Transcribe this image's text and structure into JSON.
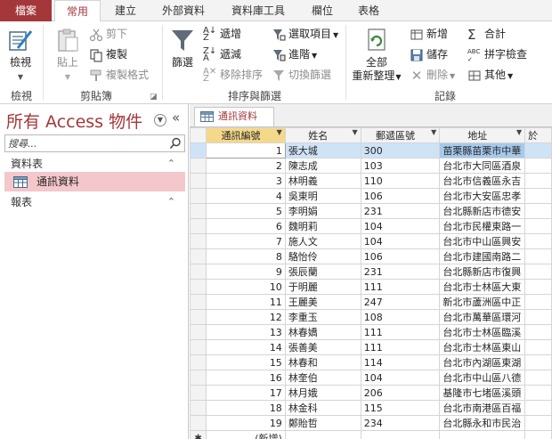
{
  "ribbon_tabs": [
    "檔案",
    "常用",
    "建立",
    "外部資料",
    "資料庫工具",
    "欄位",
    "表格"
  ],
  "ribbon": {
    "view": {
      "label1": "檢視",
      "group": "檢視"
    },
    "clipboard": {
      "paste": "貼上",
      "cut": "剪下",
      "copy": "複製",
      "format_painter": "複製格式",
      "group": "剪貼簿"
    },
    "sort_filter": {
      "filter": "篩選",
      "ascending": "遞增",
      "descending": "遞減",
      "remove_sort": "移除排序",
      "selection": "選取項目",
      "advanced": "進階",
      "toggle_filter": "切換篩選",
      "group": "排序與篩選"
    },
    "records": {
      "refresh1": "全部",
      "refresh2": "重新整理",
      "new": "新增",
      "save": "儲存",
      "delete": "刪除",
      "totals": "合計",
      "spelling": "拼字檢查",
      "more": "其他",
      "group": "記錄"
    }
  },
  "nav": {
    "title": "所有 Access 物件",
    "search_placeholder": "搜尋...",
    "groups": [
      {
        "label": "資料表",
        "items": [
          "通訊資料"
        ]
      },
      {
        "label": "報表",
        "items": []
      }
    ]
  },
  "doc_tab": "通訊資料",
  "grid": {
    "columns": [
      "通訊編號",
      "姓名",
      "郵遞區號",
      "地址",
      "於"
    ],
    "rows": [
      [
        "1",
        "張大城",
        "300",
        "苗栗縣苗栗市中華"
      ],
      [
        "2",
        "陳志成",
        "103",
        "台北市大同區酒泉"
      ],
      [
        "3",
        "林明義",
        "110",
        "台北市信義區永吉"
      ],
      [
        "4",
        "吳東明",
        "106",
        "台北市大安區忠孝"
      ],
      [
        "5",
        "李明娟",
        "231",
        "台北縣新店市德安"
      ],
      [
        "6",
        "魏明莉",
        "104",
        "台北市民權東路一"
      ],
      [
        "7",
        "施人文",
        "104",
        "台北市中山區興安"
      ],
      [
        "8",
        "駱怡伶",
        "106",
        "台北市建國南路二"
      ],
      [
        "9",
        "張辰蘭",
        "231",
        "台北縣新店市復興"
      ],
      [
        "10",
        "于明麗",
        "111",
        "台北市士林區大東"
      ],
      [
        "11",
        "王麗美",
        "247",
        "新北市蘆洲區中正"
      ],
      [
        "12",
        "李重玉",
        "108",
        "台北市萬華區環河"
      ],
      [
        "13",
        "林春嬌",
        "111",
        "台北市士林區臨溪"
      ],
      [
        "14",
        "張善美",
        "111",
        "台北市士林區東山"
      ],
      [
        "15",
        "林春和",
        "114",
        "台北市內湖區東湖"
      ],
      [
        "16",
        "林奎伯",
        "104",
        "台北市中山區八德"
      ],
      [
        "17",
        "林月娥",
        "206",
        "基隆市七堵區溪頭"
      ],
      [
        "18",
        "林金科",
        "115",
        "台北市南港區百福"
      ],
      [
        "19",
        "鄭貽哲",
        "234",
        "台北縣永和市民治"
      ]
    ],
    "new_row_label": "(新增)",
    "new_row_marker": "✱"
  }
}
